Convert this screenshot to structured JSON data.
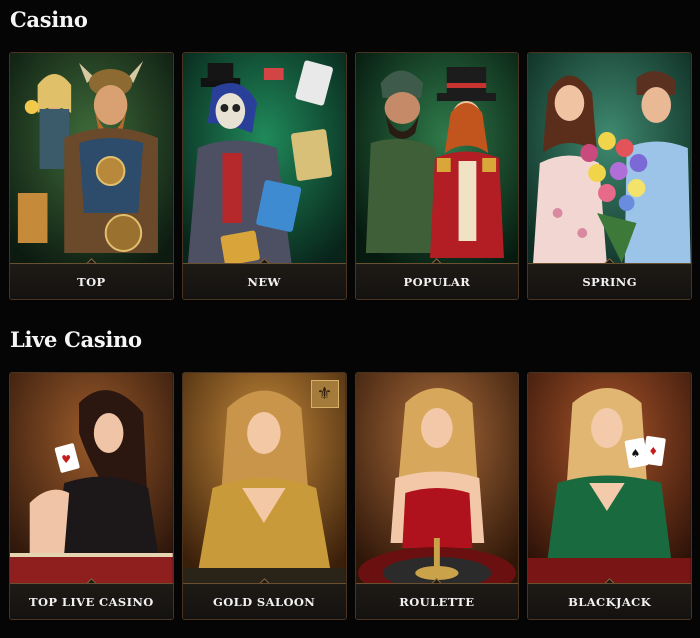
{
  "sections": [
    {
      "title": "Casino",
      "cards": [
        {
          "label": "TOP",
          "art": "viking-warrior-and-blonde-woman-art"
        },
        {
          "label": "NEW",
          "art": "tophat-skull-magician-with-cards-art"
        },
        {
          "label": "POPULAR",
          "art": "gnome-and-ringmaster-woman-art"
        },
        {
          "label": "SPRING",
          "art": "couple-with-tulip-bouquet-art"
        }
      ]
    },
    {
      "title": "Live Casino",
      "cards": [
        {
          "label": "TOP LIVE CASINO",
          "art": "brunette-dealer-holding-card-art"
        },
        {
          "label": "GOLD SALOON",
          "art": "blonde-dealer-gold-dress-art",
          "badge": "fleur-de-lis-icon"
        },
        {
          "label": "ROULETTE",
          "art": "blonde-dealer-red-dress-roulette-art"
        },
        {
          "label": "BLACKJACK",
          "art": "blonde-dealer-green-dress-cards-art"
        }
      ]
    }
  ],
  "badge_glyph": "⚜"
}
